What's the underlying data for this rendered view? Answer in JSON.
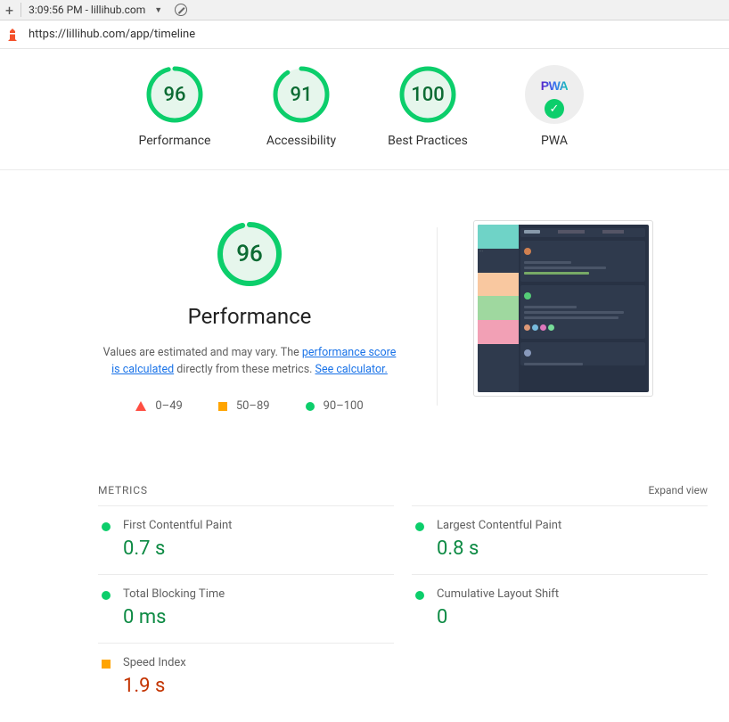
{
  "topbar": {
    "tab_title": "3:09:56 PM - lillihub.com"
  },
  "urlbar": {
    "url": "https://lillihub.com/app/timeline"
  },
  "summary": {
    "performance": {
      "score": "96",
      "label": "Performance",
      "pct": 96
    },
    "accessibility": {
      "score": "91",
      "label": "Accessibility",
      "pct": 91
    },
    "best_practices": {
      "score": "100",
      "label": "Best Practices",
      "pct": 100
    },
    "pwa": {
      "label": "PWA"
    }
  },
  "detail": {
    "score": "96",
    "pct": 96,
    "title": "Performance",
    "desc_prefix": "Values are estimated and may vary. The ",
    "desc_link1": "performance score is calculated",
    "desc_mid": " directly from these metrics. ",
    "desc_link2": "See calculator.",
    "legend": {
      "fail": "0–49",
      "avg": "50–89",
      "pass": "90–100"
    }
  },
  "metrics": {
    "heading": "METRICS",
    "expand": "Expand view",
    "items": [
      {
        "name": "First Contentful Paint",
        "value": "0.7 s",
        "status": "pass"
      },
      {
        "name": "Largest Contentful Paint",
        "value": "0.8 s",
        "status": "pass"
      },
      {
        "name": "Total Blocking Time",
        "value": "0 ms",
        "status": "pass"
      },
      {
        "name": "Cumulative Layout Shift",
        "value": "0",
        "status": "pass"
      },
      {
        "name": "Speed Index",
        "value": "1.9 s",
        "status": "avg"
      }
    ]
  }
}
